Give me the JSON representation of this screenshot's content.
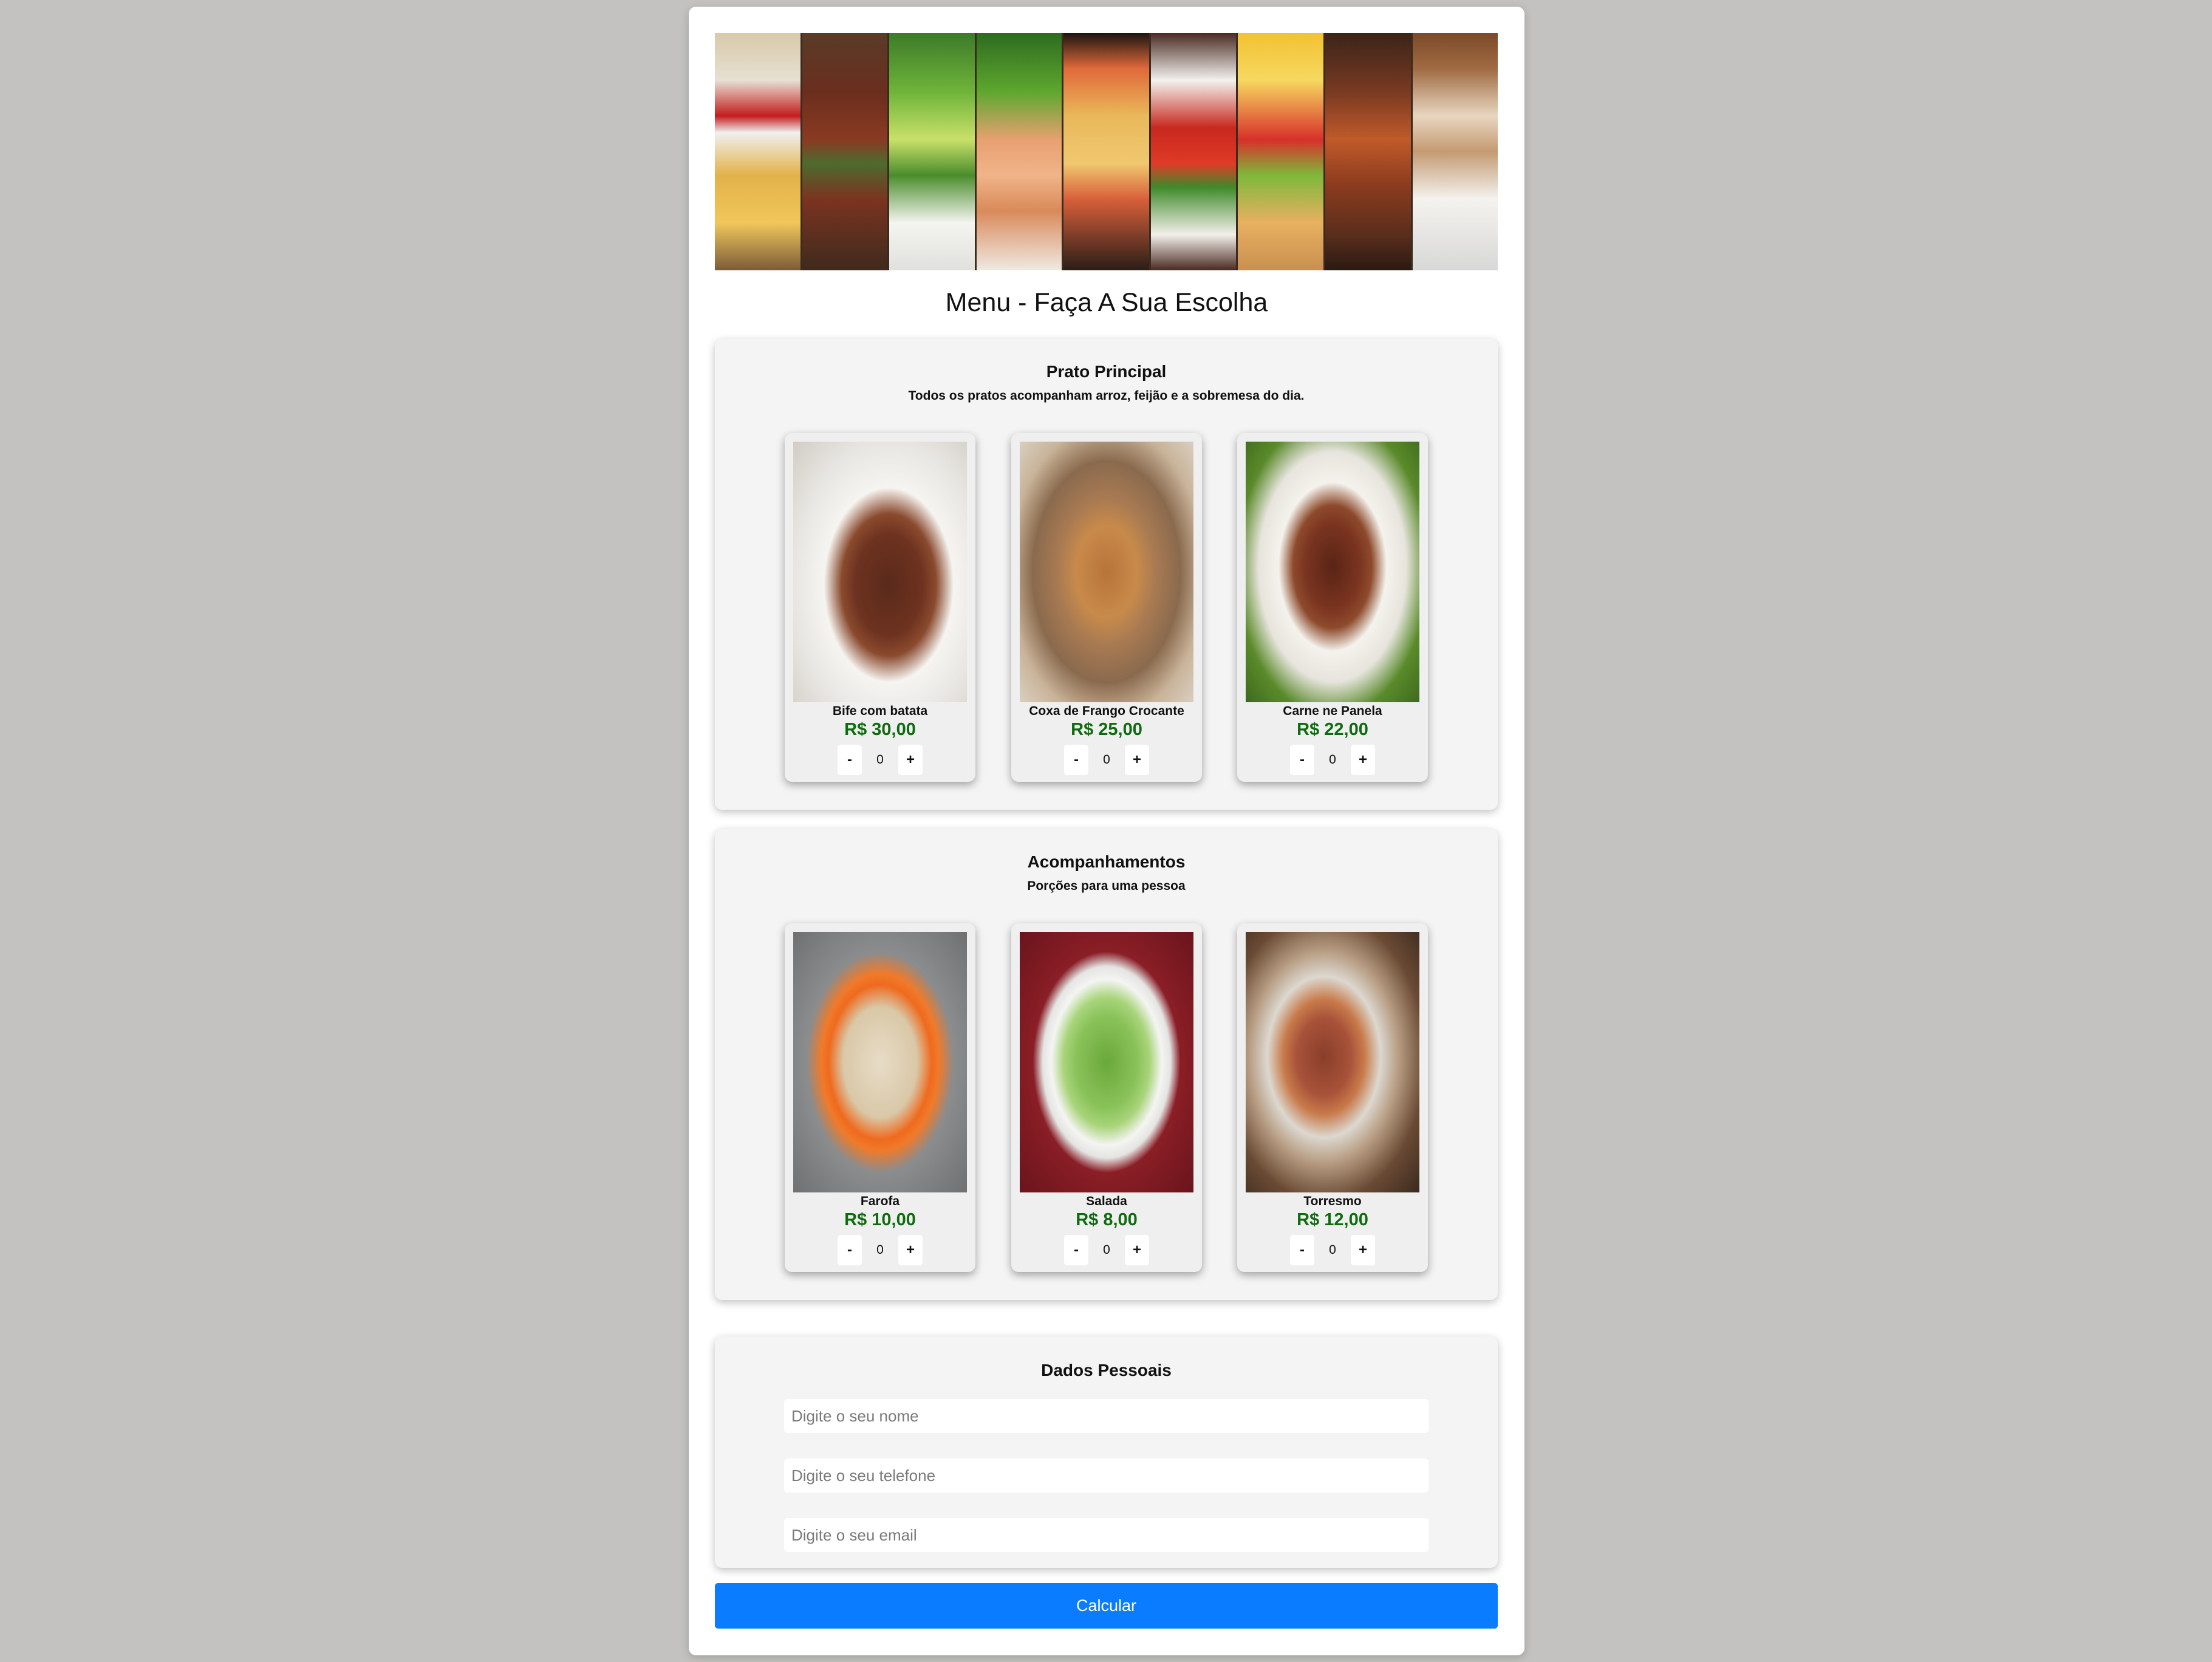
{
  "page": {
    "title": "Menu - Faça A Sua Escolha"
  },
  "banner": {
    "strips": [
      "fries-photo",
      "steak-photo",
      "salad-photo",
      "salmon-photo",
      "shrimp-pasta-photo",
      "spaghetti-photo",
      "taco-photo",
      "grilled-chicken-photo",
      "cappuccino-photo"
    ]
  },
  "sections": [
    {
      "title": "Prato Principal",
      "subtitle": "Todos os pratos acompanham arroz, feijão e a sobremesa do dia.",
      "items": [
        {
          "name": "Bife com batata",
          "price": "R$ 30,00",
          "qty": "0",
          "minus": "-",
          "plus": "+"
        },
        {
          "name": "Coxa de Frango Crocante",
          "price": "R$ 25,00",
          "qty": "0",
          "minus": "-",
          "plus": "+"
        },
        {
          "name": "Carne ne Panela",
          "price": "R$ 22,00",
          "qty": "0",
          "minus": "-",
          "plus": "+"
        }
      ]
    },
    {
      "title": "Acompanhamentos",
      "subtitle": "Porções para uma pessoa",
      "items": [
        {
          "name": "Farofa",
          "price": "R$ 10,00",
          "qty": "0",
          "minus": "-",
          "plus": "+"
        },
        {
          "name": "Salada",
          "price": "R$ 8,00",
          "qty": "0",
          "minus": "-",
          "plus": "+"
        },
        {
          "name": "Torresmo",
          "price": "R$ 12,00",
          "qty": "0",
          "minus": "-",
          "plus": "+"
        }
      ]
    }
  ],
  "personal": {
    "title": "Dados Pessoais",
    "name_placeholder": "Digite o seu nome",
    "phone_placeholder": "Digite o seu telefone",
    "email_placeholder": "Digite o seu email"
  },
  "calculate_label": "Calcular",
  "colors": {
    "accent": "#0a7cff",
    "price": "#0f6b0f",
    "background": "#c3c2c0"
  }
}
